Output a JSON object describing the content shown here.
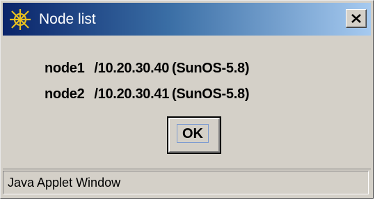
{
  "window": {
    "title": "Node list",
    "icon": "gear-asterisk-icon",
    "close_icon": "close-icon"
  },
  "nodes": [
    {
      "name": "node1",
      "address": "/10.20.30.40",
      "os": "(SunOS-5.8)"
    },
    {
      "name": "node2",
      "address": "/10.20.30.41",
      "os": "(SunOS-5.8)"
    }
  ],
  "buttons": {
    "ok_label": "OK"
  },
  "status_bar": {
    "text": "Java Applet Window"
  },
  "colors": {
    "titlebar_start": "#0a246a",
    "titlebar_end": "#a6caf0",
    "face": "#d4d0c8",
    "title_text": "#ffffff",
    "icon_yellow": "#f0d020"
  }
}
